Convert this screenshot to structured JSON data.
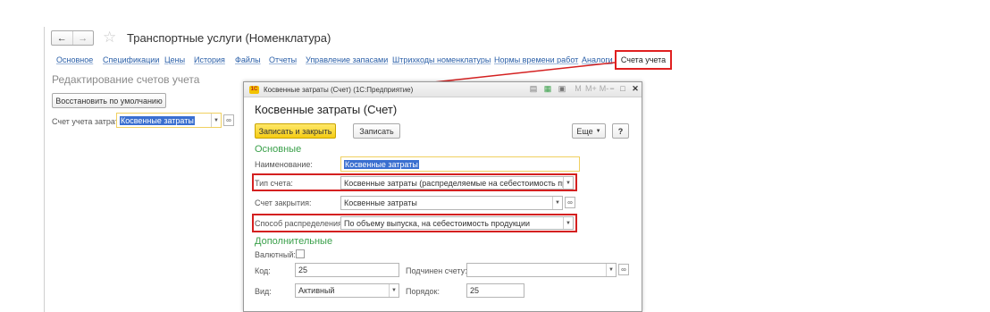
{
  "header": {
    "back_glyph": "←",
    "forward_glyph": "→",
    "star_glyph": "☆",
    "title": "Транспортные услуги (Номенклатура)"
  },
  "tabs": [
    "Основное",
    "Спецификации",
    "Цены",
    "История",
    "Файлы",
    "Отчеты",
    "Управление запасами",
    "Штрихкоды номенклатуры",
    "Нормы времени работ",
    "Аналоги"
  ],
  "active_tab": "Счета учета",
  "left_form": {
    "subtitle": "Редактирование счетов учета",
    "restore_button": "Восстановить по умолчанию",
    "cost_account_label": "Счет учета затрат:",
    "cost_account_value": "Косвенные затраты"
  },
  "dialog": {
    "window_title": "Косвенные затраты (Счет) (1С:Предприятие)",
    "logo": "1С",
    "toolbar_icons": [
      "▤",
      "▦",
      "▣",
      "M",
      "M+",
      "M-",
      "−",
      "□",
      "✕"
    ],
    "heading": "Косвенные затраты (Счет)",
    "save_close_button": "Записать и закрыть",
    "save_button": "Записать",
    "more_button": "Еще",
    "help_button": "?",
    "section_main": "Основные",
    "name_label": "Наименование:",
    "name_value": "Косвенные затраты",
    "account_type_label": "Тип счета:",
    "account_type_value": "Косвенные затраты (распределяемые на себестоимость продукции)",
    "closing_account_label": "Счет закрытия:",
    "closing_account_value": "Косвенные затраты",
    "distribution_label": "Способ распределения:",
    "distribution_value": "По объему выпуска, на себестоимость продукции",
    "section_extra": "Дополнительные",
    "currency_label": "Валютный:",
    "code_label": "Код:",
    "code_value": "25",
    "parent_label": "Подчинен счету:",
    "parent_value": "",
    "kind_label": "Вид:",
    "kind_value": "Активный",
    "order_label": "Порядок:",
    "order_value": "25"
  },
  "colors": {
    "accent_link": "#2a5fa8",
    "highlight_red": "#d42020",
    "primary_yellow": "#f5cc14",
    "section_green": "#3aa04a"
  }
}
